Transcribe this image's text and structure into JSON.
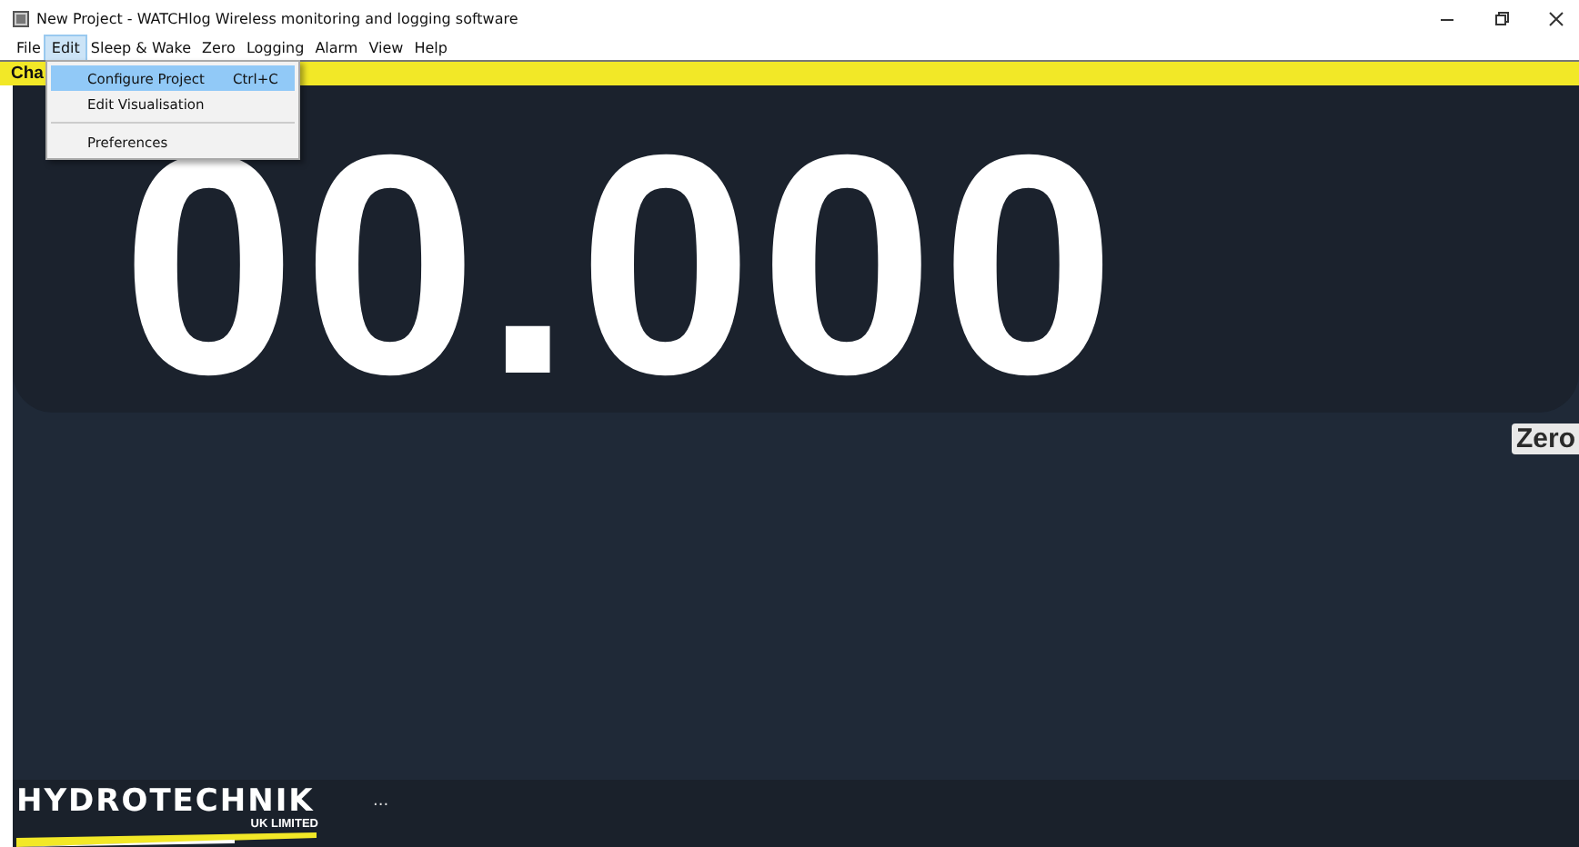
{
  "window": {
    "title": "New Project - WATCHlog Wireless monitoring and logging software"
  },
  "menu": [
    {
      "label": "File",
      "selected": false
    },
    {
      "label": "Edit",
      "selected": true
    },
    {
      "label": "Sleep & Wake",
      "selected": false
    },
    {
      "label": "Zero",
      "selected": false
    },
    {
      "label": "Logging",
      "selected": false
    },
    {
      "label": "Alarm",
      "selected": false
    },
    {
      "label": "View",
      "selected": false
    },
    {
      "label": "Help",
      "selected": false
    }
  ],
  "dropdown": [
    {
      "label": "Configure Project",
      "shortcut": "Ctrl+C",
      "selected": true,
      "separator_after": false
    },
    {
      "label": "Edit Visualisation",
      "selected": false,
      "separator_after": true
    },
    {
      "label": "Preferences",
      "selected": false,
      "separator_after": false
    }
  ],
  "channel_bar": {
    "label": "Cha"
  },
  "display": {
    "value": "00.000"
  },
  "zero_button": {
    "label": "Zero"
  },
  "footer": {
    "logo": {
      "name": "HYDROTECHNIK",
      "sub": "UK LIMITED"
    },
    "ellipsis": "..."
  }
}
